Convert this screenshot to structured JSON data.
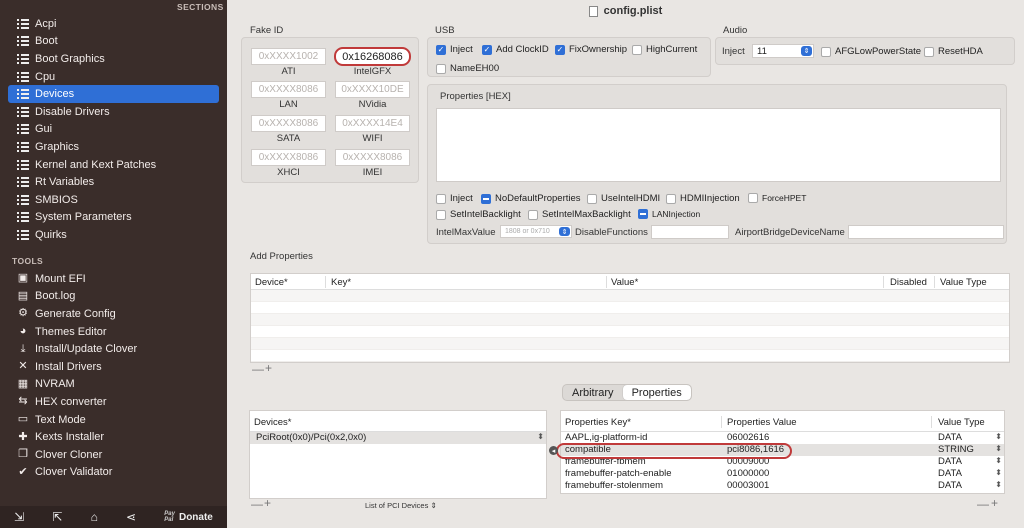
{
  "sidebar": {
    "sections_label": "SECTIONS",
    "tools_label": "TOOLS",
    "sections": [
      {
        "label": "Acpi",
        "selected": false
      },
      {
        "label": "Boot",
        "selected": false
      },
      {
        "label": "Boot Graphics",
        "selected": false
      },
      {
        "label": "Cpu",
        "selected": false
      },
      {
        "label": "Devices",
        "selected": true
      },
      {
        "label": "Disable Drivers",
        "selected": false
      },
      {
        "label": "Gui",
        "selected": false
      },
      {
        "label": "Graphics",
        "selected": false
      },
      {
        "label": "Kernel and Kext Patches",
        "selected": false
      },
      {
        "label": "Rt Variables",
        "selected": false
      },
      {
        "label": "SMBIOS",
        "selected": false
      },
      {
        "label": "System Parameters",
        "selected": false
      },
      {
        "label": "Quirks",
        "selected": false
      }
    ],
    "tools": [
      {
        "label": "Mount EFI",
        "icon": "drive-icon"
      },
      {
        "label": "Boot.log",
        "icon": "log-icon"
      },
      {
        "label": "Generate Config",
        "icon": "gears-icon"
      },
      {
        "label": "Themes Editor",
        "icon": "palette-icon"
      },
      {
        "label": "Install/Update Clover",
        "icon": "download-icon"
      },
      {
        "label": "Install Drivers",
        "icon": "wrench-icon"
      },
      {
        "label": "NVRAM",
        "icon": "chip-icon"
      },
      {
        "label": "HEX converter",
        "icon": "exchange-icon"
      },
      {
        "label": "Text Mode",
        "icon": "text-icon"
      },
      {
        "label": "Kexts Installer",
        "icon": "puzzle-icon"
      },
      {
        "label": "Clover Cloner",
        "icon": "clone-icon"
      },
      {
        "label": "Clover Validator",
        "icon": "check-icon"
      }
    ],
    "toolbar": {
      "pay_top": "Pay",
      "pay_bottom": "Pal",
      "donate": "Donate"
    }
  },
  "window": {
    "title": "config.plist"
  },
  "fake_id": {
    "label": "Fake ID",
    "fields": [
      {
        "value": "0xXXXX1002",
        "label": "ATI",
        "placeholder": true
      },
      {
        "value": "0x16268086",
        "label": "IntelGFX",
        "placeholder": false
      },
      {
        "value": "0xXXXX8086",
        "label": "LAN",
        "placeholder": true
      },
      {
        "value": "0xXXXX10DE",
        "label": "NVidia",
        "placeholder": true
      },
      {
        "value": "0xXXXX8086",
        "label": "SATA",
        "placeholder": true
      },
      {
        "value": "0xXXXX14E4",
        "label": "WIFI",
        "placeholder": true
      },
      {
        "value": "0xXXXX8086",
        "label": "XHCI",
        "placeholder": true
      },
      {
        "value": "0xXXXX8086",
        "label": "IMEI",
        "placeholder": true
      }
    ]
  },
  "usb": {
    "label": "USB",
    "options": [
      {
        "label": "Inject",
        "checked": true
      },
      {
        "label": "Add ClockID",
        "checked": true
      },
      {
        "label": "FixOwnership",
        "checked": true
      },
      {
        "label": "HighCurrent",
        "checked": false
      },
      {
        "label": "NameEH00",
        "checked": false
      }
    ]
  },
  "audio": {
    "label": "Audio",
    "inject_label": "Inject",
    "inject_value": "11",
    "options": [
      {
        "label": "AFGLowPowerState",
        "checked": false
      },
      {
        "label": "ResetHDA",
        "checked": false
      }
    ]
  },
  "properties_hex": {
    "label": "Properties [HEX]"
  },
  "device_flags": [
    {
      "label": "Inject",
      "state": "off"
    },
    {
      "label": "NoDefaultProperties",
      "state": "dash"
    },
    {
      "label": "UseIntelHDMI",
      "state": "off"
    },
    {
      "label": "HDMIInjection",
      "state": "off"
    },
    {
      "label": "ForceHPET",
      "state": "off"
    },
    {
      "label": "SetIntelBacklight",
      "state": "off"
    },
    {
      "label": "SetIntelMaxBacklight",
      "state": "off"
    },
    {
      "label": "LANInjection",
      "state": "dash"
    }
  ],
  "intel_max": {
    "label": "IntelMaxValue",
    "placeholder": "1808 or 0x710"
  },
  "disable_functions": {
    "label": "DisableFunctions"
  },
  "airport": {
    "label": "AirportBridgeDeviceName"
  },
  "add_properties": {
    "label": "Add Properties",
    "columns": [
      "Device*",
      "Key*",
      "Value*",
      "Disabled",
      "Value Type"
    ]
  },
  "tabs": [
    {
      "label": "Arbitrary",
      "active": false
    },
    {
      "label": "Properties",
      "active": true
    }
  ],
  "devices_table": {
    "header": "Devices*",
    "rows": [
      "PciRoot(0x0)/Pci(0x2,0x0)"
    ],
    "footer": "List of PCI Devices"
  },
  "props_table": {
    "columns": [
      "Properties Key*",
      "Properties Value",
      "Value Type"
    ],
    "rows": [
      {
        "key": "AAPL,ig-platform-id",
        "value": "06002616",
        "type": "DATA"
      },
      {
        "key": "compatible",
        "value": "pci8086,1616",
        "type": "STRING"
      },
      {
        "key": "framebuffer-fbmem",
        "value": "00009000",
        "type": "DATA"
      },
      {
        "key": "framebuffer-patch-enable",
        "value": "01000000",
        "type": "DATA"
      },
      {
        "key": "framebuffer-stolenmem",
        "value": "00003001",
        "type": "DATA"
      }
    ]
  },
  "colors": {
    "accent": "#2f6fd6",
    "highlight": "#c03a3a",
    "sidebar": "#3a2d2a"
  }
}
